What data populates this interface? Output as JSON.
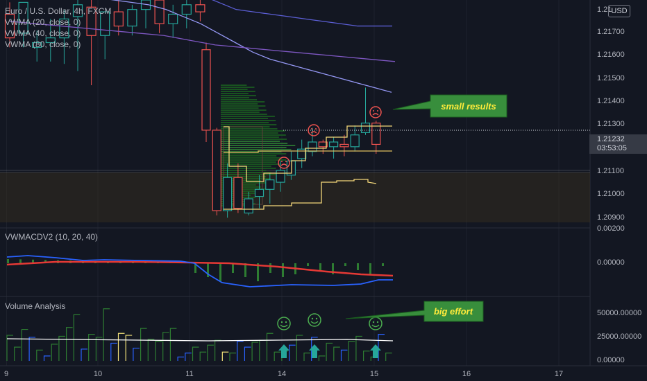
{
  "header": {
    "symbol_line": "Euro / U.S. Dollar, 4h, FXCM",
    "indicators": [
      "VWMA (20, close, 0)",
      "VWMA (40, close, 0)",
      "VWMA (80, close, 0)"
    ]
  },
  "currency_badge": "USD",
  "current_price": {
    "price": "1.21232",
    "countdown": "03:53:05"
  },
  "price_axis": {
    "labels": [
      "1.21700",
      "1.21600",
      "1.21500",
      "1.21400",
      "1.21300",
      "1.21100",
      "1.21000",
      "1.20900"
    ],
    "top_partial": "1.21",
    "min": 1.2088,
    "max": 1.2184
  },
  "time_axis": {
    "labels": [
      "9",
      "10",
      "11",
      "14",
      "15",
      "16",
      "17"
    ]
  },
  "macd_panel": {
    "title": "VWMACDV2 (10, 20, 40)",
    "axis_labels": [
      "0.00000"
    ],
    "top_partial": "0.00200"
  },
  "volume_panel": {
    "title": "Volume Analysis",
    "axis_labels": [
      "50000.00000",
      "25000.00000",
      "0.00000"
    ]
  },
  "annotations": {
    "small_results": "small results",
    "big_effort": "big effort"
  },
  "colors": {
    "background": "#131722",
    "bull_candle": "#26a69a",
    "bear_candle": "#ef5350",
    "vwma20": "#9598f5",
    "vwma40": "#7e57c2",
    "vwma80": "#5c5fd6",
    "macd_line": "#2962ff",
    "signal_line": "#e53935",
    "callout": "#388e3c",
    "callout_text": "#ffeb3b"
  },
  "chart_data": {
    "type": "candlestick",
    "candles": [
      {
        "o": 1.2178,
        "h": 1.2183,
        "l": 1.2164,
        "c": 1.2168
      },
      {
        "o": 1.217,
        "h": 1.2183,
        "l": 1.2164,
        "c": 1.2183
      },
      {
        "o": 1.2164,
        "h": 1.2171,
        "l": 1.2158,
        "c": 1.2166
      },
      {
        "o": 1.2166,
        "h": 1.2176,
        "l": 1.2158,
        "c": 1.2168
      },
      {
        "o": 1.2168,
        "h": 1.218,
        "l": 1.2157,
        "c": 1.2176
      },
      {
        "o": 1.2177,
        "h": 1.2184,
        "l": 1.2154,
        "c": 1.2182
      },
      {
        "o": 1.2181,
        "h": 1.2186,
        "l": 1.2148,
        "c": 1.2169
      },
      {
        "o": 1.2169,
        "h": 1.2178,
        "l": 1.2159,
        "c": 1.2179
      },
      {
        "o": 1.2179,
        "h": 1.2184,
        "l": 1.2169,
        "c": 1.2173
      },
      {
        "o": 1.2173,
        "h": 1.2182,
        "l": 1.2169,
        "c": 1.218
      },
      {
        "o": 1.218,
        "h": 1.2185,
        "l": 1.2172,
        "c": 1.2184
      },
      {
        "o": 1.2184,
        "h": 1.2187,
        "l": 1.217,
        "c": 1.2174
      },
      {
        "o": 1.2174,
        "h": 1.2182,
        "l": 1.2168,
        "c": 1.2178
      },
      {
        "o": 1.2178,
        "h": 1.2184,
        "l": 1.2172,
        "c": 1.2182
      },
      {
        "o": 1.2182,
        "h": 1.2185,
        "l": 1.2175,
        "c": 1.2179
      },
      {
        "o": 1.2163,
        "h": 1.2166,
        "l": 1.2124,
        "c": 1.2129
      },
      {
        "o": 1.2129,
        "h": 1.213,
        "l": 1.2093,
        "c": 1.2095
      },
      {
        "o": 1.2095,
        "h": 1.2115,
        "l": 1.2092,
        "c": 1.2109
      },
      {
        "o": 1.2109,
        "h": 1.2115,
        "l": 1.2094,
        "c": 1.2096
      },
      {
        "o": 1.2094,
        "h": 1.2103,
        "l": 1.2093,
        "c": 1.21
      },
      {
        "o": 1.2101,
        "h": 1.211,
        "l": 1.2096,
        "c": 1.2104
      },
      {
        "o": 1.2104,
        "h": 1.2111,
        "l": 1.2098,
        "c": 1.2108
      },
      {
        "o": 1.2107,
        "h": 1.2116,
        "l": 1.2103,
        "c": 1.2112
      },
      {
        "o": 1.211,
        "h": 1.212,
        "l": 1.2108,
        "c": 1.2116
      },
      {
        "o": 1.2117,
        "h": 1.2125,
        "l": 1.2113,
        "c": 1.2121
      },
      {
        "o": 1.212,
        "h": 1.213,
        "l": 1.2118,
        "c": 1.2124
      },
      {
        "o": 1.2124,
        "h": 1.2125,
        "l": 1.2119,
        "c": 1.2122
      },
      {
        "o": 1.2122,
        "h": 1.2126,
        "l": 1.2117,
        "c": 1.2124
      },
      {
        "o": 1.2123,
        "h": 1.2127,
        "l": 1.2118,
        "c": 1.2122
      },
      {
        "o": 1.2122,
        "h": 1.2131,
        "l": 1.212,
        "c": 1.2127
      },
      {
        "o": 1.2128,
        "h": 1.2147,
        "l": 1.2127,
        "c": 1.2132
      },
      {
        "o": 1.2132,
        "h": 1.2133,
        "l": 1.2119,
        "c": 1.2123
      }
    ],
    "vwma20": [
      1.219,
      1.2189,
      1.2188,
      1.2187,
      1.2186,
      1.2185,
      1.2184,
      1.2183,
      1.2182,
      1.218,
      1.2177,
      1.2174,
      1.217,
      1.2166,
      1.2162,
      1.2159,
      1.2157,
      1.2155,
      1.2153,
      1.2151,
      1.2149,
      1.2147,
      1.2145
    ],
    "vwma40": [
      1.2175,
      1.2174,
      1.2173,
      1.2172,
      1.2171,
      1.217,
      1.2169,
      1.2167,
      1.2165,
      1.2164,
      1.2163,
      1.2162,
      1.2161,
      1.216,
      1.2159,
      1.2158
    ],
    "vwma80": [
      1.2191,
      1.2189,
      1.2186,
      1.2183,
      1.218,
      1.2179,
      1.2178,
      1.2177,
      1.2176,
      1.2175,
      1.2174,
      1.2173,
      1.2173,
      1.2173
    ],
    "volume": [
      26000,
      14000,
      32000,
      24000,
      11000,
      5000,
      17000,
      25000,
      34000,
      47000,
      12000,
      27000,
      24000,
      53000,
      18000,
      28000,
      26000,
      13000,
      33000,
      22000,
      20000,
      29000,
      33000,
      4000,
      8000,
      14000,
      9000,
      16000,
      21000,
      9000,
      8000,
      20000,
      14000,
      19000,
      21000,
      28000,
      9000,
      10000,
      16000,
      26000,
      8000,
      24000,
      5000,
      18000,
      14000,
      11000,
      20000,
      25000,
      10000,
      4000,
      27000,
      8000
    ]
  }
}
